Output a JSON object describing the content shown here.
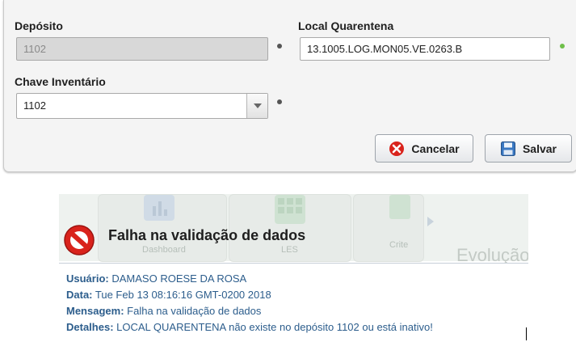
{
  "form": {
    "deposito_label": "Depósito",
    "deposito_value": "1102",
    "local_label": "Local Quarentena",
    "local_value": "13.1005.LOG.MON05.VE.0263.B",
    "chave_label": "Chave Inventário",
    "chave_value": "1102",
    "cancel_label": "Cancelar",
    "save_label": "Salvar"
  },
  "background_tiles": {
    "tile1": "Dashboard",
    "tile2": "LES",
    "tile3": "Crite",
    "tile4": "Evolução"
  },
  "error": {
    "title": "Falha na validação de dados",
    "usuario_label": "Usuário:",
    "usuario_value": "DAMASO ROESE DA ROSA",
    "data_label": "Data:",
    "data_value": "Tue Feb 13 08:16:16 GMT-0200 2018",
    "mensagem_label": "Mensagem:",
    "mensagem_value": "Falha na validação de dados",
    "detalhes_label": "Detalhes:",
    "detalhes_value": "LOCAL QUARENTENA não existe no depósito 1102 ou está inativo!"
  },
  "colors": {
    "panel_bg": "#f4f4f4",
    "detail_text": "#2c5d8c",
    "error_red": "#d9231c",
    "status_ok": "#6fbf4a"
  },
  "icons": [
    "cancel-icon",
    "save-icon",
    "error-icon",
    "chevron-down-icon"
  ]
}
